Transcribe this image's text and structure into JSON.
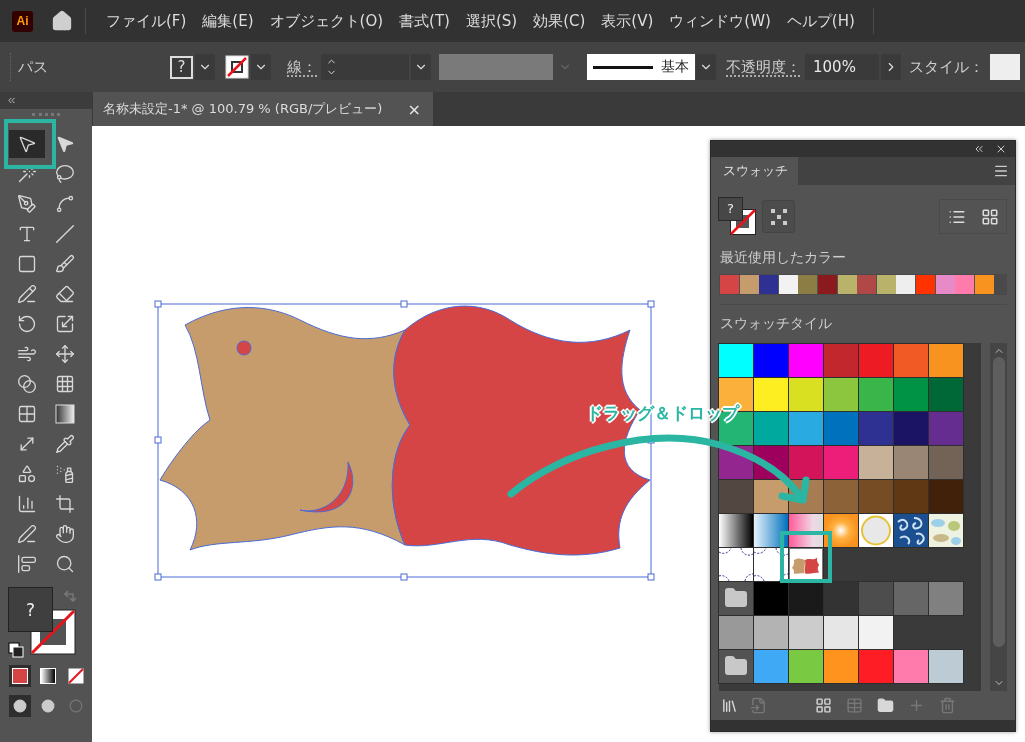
{
  "app": {
    "logo": "Ai"
  },
  "menu": [
    "ファイル(F)",
    "編集(E)",
    "オブジェクト(O)",
    "書式(T)",
    "選択(S)",
    "効果(C)",
    "表示(V)",
    "ウィンドウ(W)",
    "ヘルプ(H)"
  ],
  "control_bar": {
    "selection_label": "パス",
    "fill_text": "?",
    "stroke_label": "線：",
    "stroke_profile": "基本",
    "opacity_label": "不透明度：",
    "opacity_value": "100%",
    "style_label": "スタイル："
  },
  "tools": [
    {
      "kind": "selection",
      "selected": true
    },
    {
      "kind": "direct",
      "selected": false
    },
    {
      "kind": "wand",
      "selected": false
    },
    {
      "kind": "lasso",
      "selected": false
    },
    {
      "kind": "pen",
      "selected": false
    },
    {
      "kind": "curvature",
      "selected": false
    },
    {
      "kind": "type",
      "selected": false
    },
    {
      "kind": "line",
      "selected": false
    },
    {
      "kind": "rectangle",
      "selected": false
    },
    {
      "kind": "brush",
      "selected": false
    },
    {
      "kind": "shaper",
      "selected": false
    },
    {
      "kind": "eraser",
      "selected": false
    },
    {
      "kind": "rotate",
      "selected": false
    },
    {
      "kind": "scale",
      "selected": false
    },
    {
      "kind": "warp",
      "selected": false
    },
    {
      "kind": "transform",
      "selected": false
    },
    {
      "kind": "builder",
      "selected": false
    },
    {
      "kind": "perspective",
      "selected": false
    },
    {
      "kind": "mesh",
      "selected": false
    },
    {
      "kind": "gradient",
      "selected": false
    },
    {
      "kind": "width",
      "selected": false
    },
    {
      "kind": "eyedropper",
      "selected": false
    },
    {
      "kind": "symbol",
      "selected": false
    },
    {
      "kind": "spray",
      "selected": false
    },
    {
      "kind": "graph",
      "selected": false
    },
    {
      "kind": "artboard",
      "selected": false
    },
    {
      "kind": "nib",
      "selected": false
    },
    {
      "kind": "hand",
      "selected": false
    },
    {
      "kind": "align",
      "selected": false
    },
    {
      "kind": "zoom",
      "selected": false
    }
  ],
  "fill_stroke": {
    "fill_text": "?"
  },
  "document_tab": {
    "title": "名称未設定-1* @ 100.79 % (RGB/プレビュー)",
    "close": "×"
  },
  "swatches_panel": {
    "tab": "スウォッチ",
    "fill_text": "?",
    "recent_heading": "最近使用したカラー",
    "recent_colors": [
      {
        "color": "#d64545"
      },
      {
        "color": "#c69c6d"
      },
      {
        "color": "#2e3192"
      },
      {
        "color": "#f2f2f2"
      },
      {
        "color": "#8c7d45"
      },
      {
        "color": "#8b1a1f"
      },
      {
        "color": "#b9b26a"
      },
      {
        "color": "#b04848"
      },
      {
        "color": "#b9b26a"
      },
      {
        "color": "#eeeeee"
      },
      {
        "color": "#ff3300"
      },
      {
        "color": "#e68ac8"
      },
      {
        "color": "#ff7bac"
      },
      {
        "color": "#f7931e"
      }
    ],
    "library_heading": "スウォッチタイル",
    "swatch_rows": [
      {
        "cells": [
          {
            "kind": "color",
            "color": "#00ffff"
          },
          {
            "kind": "color",
            "color": "#0000ff"
          },
          {
            "kind": "color",
            "color": "#ff00ff"
          },
          {
            "kind": "color",
            "color": "#c1272d"
          },
          {
            "kind": "color",
            "color": "#ed1c24"
          },
          {
            "kind": "color",
            "color": "#f15a24"
          },
          {
            "kind": "color",
            "color": "#f7931e"
          }
        ]
      },
      {
        "cells": [
          {
            "kind": "color",
            "color": "#fbb03b"
          },
          {
            "kind": "color",
            "color": "#fcee21"
          },
          {
            "kind": "color",
            "color": "#d9e021"
          },
          {
            "kind": "color",
            "color": "#8cc63f"
          },
          {
            "kind": "color",
            "color": "#39b54a"
          },
          {
            "kind": "color",
            "color": "#009245"
          },
          {
            "kind": "color",
            "color": "#006837"
          }
        ]
      },
      {
        "cells": [
          {
            "kind": "color",
            "color": "#22b573"
          },
          {
            "kind": "color",
            "color": "#00a99d"
          },
          {
            "kind": "color",
            "color": "#29abe2"
          },
          {
            "kind": "color",
            "color": "#0071bc"
          },
          {
            "kind": "color",
            "color": "#2e3192"
          },
          {
            "kind": "color",
            "color": "#1b1464"
          },
          {
            "kind": "color",
            "color": "#662d91"
          }
        ]
      },
      {
        "cells": [
          {
            "kind": "color",
            "color": "#93278f"
          },
          {
            "kind": "color",
            "color": "#9e005d"
          },
          {
            "kind": "color",
            "color": "#d4145a"
          },
          {
            "kind": "color",
            "color": "#ed1e79"
          },
          {
            "kind": "color",
            "color": "#c7b299"
          },
          {
            "kind": "color",
            "color": "#998675"
          },
          {
            "kind": "color",
            "color": "#736357"
          }
        ]
      },
      {
        "cells": [
          {
            "kind": "color",
            "color": "#534741"
          },
          {
            "kind": "color",
            "color": "#c69c6d"
          },
          {
            "kind": "color",
            "color": "#a67c52"
          },
          {
            "kind": "color",
            "color": "#8c6239"
          },
          {
            "kind": "color",
            "color": "#754c24"
          },
          {
            "kind": "color",
            "color": "#603813"
          },
          {
            "kind": "color",
            "color": "#42210b"
          }
        ]
      },
      {
        "cells": [
          {
            "kind": "fade"
          },
          {
            "kind": "bluefade"
          },
          {
            "kind": "halftone"
          },
          {
            "kind": "glow"
          },
          {
            "kind": "ring"
          },
          {
            "kind": "swirl"
          },
          {
            "kind": "camo"
          }
        ]
      },
      {
        "cells": [
          {
            "kind": "scallop"
          },
          {
            "kind": "scallop"
          },
          {
            "kind": "artwork"
          }
        ]
      },
      {
        "cells": [
          {
            "kind": "folder"
          },
          {
            "kind": "color",
            "color": "#000000"
          },
          {
            "kind": "color",
            "color": "#1a1a1a"
          },
          {
            "kind": "color",
            "color": "#333333"
          },
          {
            "kind": "color",
            "color": "#4d4d4d"
          },
          {
            "kind": "color",
            "color": "#666666"
          },
          {
            "kind": "color",
            "color": "#808080"
          }
        ]
      },
      {
        "cells": [
          {
            "kind": "color",
            "color": "#999999"
          },
          {
            "kind": "color",
            "color": "#b3b3b3"
          },
          {
            "kind": "color",
            "color": "#cccccc"
          },
          {
            "kind": "color",
            "color": "#e6e6e6"
          },
          {
            "kind": "color",
            "color": "#f2f2f2"
          }
        ]
      },
      {
        "cells": [
          {
            "kind": "folder"
          },
          {
            "kind": "color",
            "color": "#3fa9f5"
          },
          {
            "kind": "color",
            "color": "#7ac943"
          },
          {
            "kind": "color",
            "color": "#ff931e"
          },
          {
            "kind": "color",
            "color": "#ff1d25"
          },
          {
            "kind": "color",
            "color": "#ff7bac"
          },
          {
            "kind": "color",
            "color": "#bdccd4"
          }
        ]
      }
    ]
  },
  "annotation": {
    "text": "ドラッグ＆ドロップ"
  }
}
